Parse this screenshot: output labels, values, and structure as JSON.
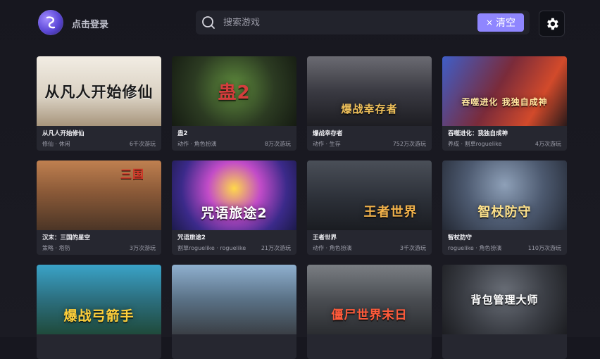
{
  "header": {
    "login_label": "点击登录",
    "search_placeholder": "搜索游戏",
    "clear_label": "清空",
    "clear_icon": "×"
  },
  "games": [
    {
      "title": "从凡人开始修仙",
      "tags": "修仙 · 休闲",
      "plays": "6千次游玩",
      "art": "从凡人开始修仙"
    },
    {
      "title": "蛊2",
      "tags": "动作 · 角色扮演",
      "plays": "8万次游玩",
      "art": "蛊2"
    },
    {
      "title": "爆战幸存者",
      "tags": "动作 · 生存",
      "plays": "752万次游玩",
      "art": "爆战幸存者"
    },
    {
      "title": "吞噬进化：我独自成神",
      "tags": "养成 · 割草roguelike",
      "plays": "4万次游玩",
      "art": "吞噬进化 我独自成神"
    },
    {
      "title": "汉末：三国的星空",
      "tags": "策略 · 塔防",
      "plays": "3万次游玩",
      "art": "三国"
    },
    {
      "title": "咒语旅途2",
      "tags": "割草roguelike · roguelike",
      "plays": "21万次游玩",
      "art": "咒语旅途2"
    },
    {
      "title": "王者世界",
      "tags": "动作 · 角色扮演",
      "plays": "3千次游玩",
      "art": "王者世界"
    },
    {
      "title": "智杖防守",
      "tags": "roguelike · 角色扮演",
      "plays": "110万次游玩",
      "art": "智杖防守"
    },
    {
      "title": "",
      "tags": "",
      "plays": "",
      "art": "爆战弓箭手"
    },
    {
      "title": "",
      "tags": "",
      "plays": "",
      "art": ""
    },
    {
      "title": "",
      "tags": "",
      "plays": "",
      "art": "僵尸世界末日"
    },
    {
      "title": "",
      "tags": "",
      "plays": "",
      "art": "背包管理大师"
    }
  ]
}
